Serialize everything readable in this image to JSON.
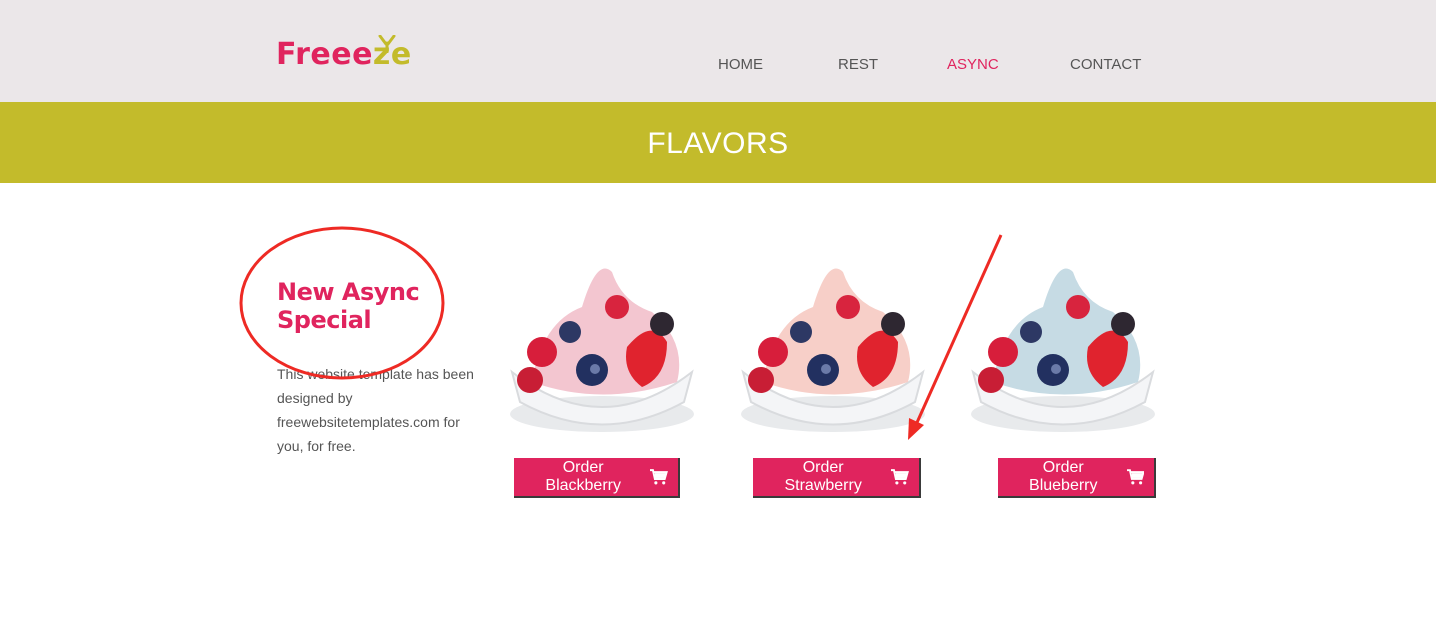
{
  "header": {
    "logo_main": "Freee",
    "logo_accent": "ze",
    "nav": [
      {
        "label": "HOME"
      },
      {
        "label": "REST"
      },
      {
        "label": "ASYNC"
      },
      {
        "label": "CONTACT"
      }
    ],
    "active_nav": "ASYNC"
  },
  "banner": {
    "title": "FLAVORS"
  },
  "special": {
    "title": "New Async Special",
    "body": "This website template has been designed by freewebsitetemplates.com for you, for free."
  },
  "products": [
    {
      "button_label": "Order Blackberry",
      "tint": "#f3c6d0",
      "icon": "cart-icon"
    },
    {
      "button_label": "Order Strawberry",
      "tint": "#f7cfc8",
      "icon": "cart-icon"
    },
    {
      "button_label": "Order Blueberry",
      "tint": "#c6dbe4",
      "icon": "cart-icon"
    }
  ],
  "colors": {
    "brand": "#e0245e",
    "accent": "#c3bb2b",
    "header_bg": "#ebe7e9",
    "annotation": "#ee2a24"
  }
}
